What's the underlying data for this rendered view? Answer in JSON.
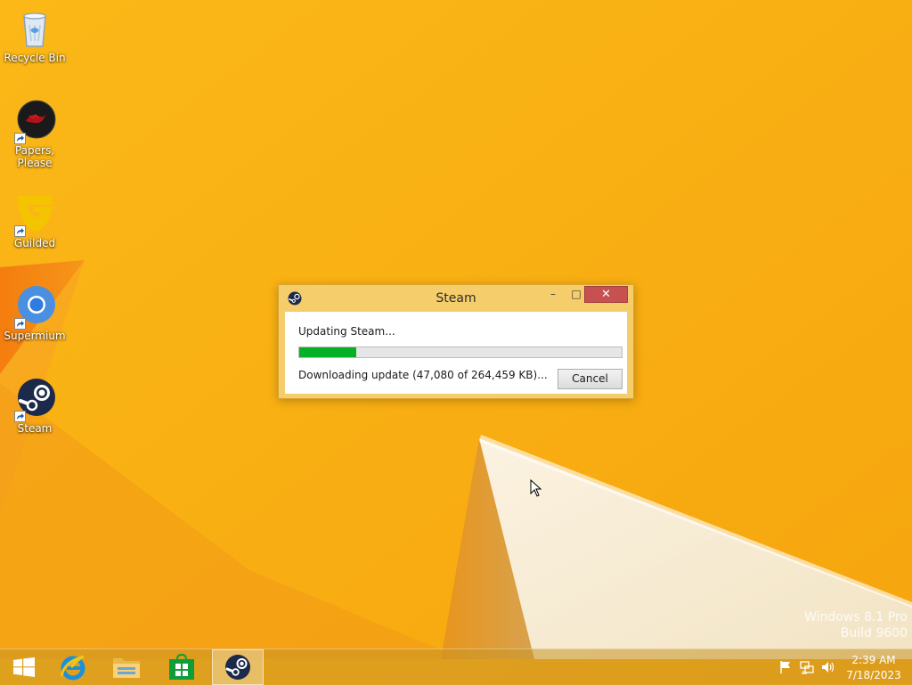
{
  "desktop": {
    "icons": [
      {
        "label": "Recycle Bin",
        "icon": "recycle-bin-icon"
      },
      {
        "label": "Papers, Please",
        "icon": "papers-please-icon"
      },
      {
        "label": "Guilded",
        "icon": "guilded-icon"
      },
      {
        "label": "Supermium",
        "icon": "supermium-icon"
      },
      {
        "label": "Steam",
        "icon": "steam-icon"
      }
    ]
  },
  "dialog": {
    "title": "Steam",
    "status": "Updating Steam...",
    "detail": "Downloading update (47,080 of 264,459 KB)...",
    "cancel_label": "Cancel",
    "progress_fraction": 0.178,
    "minimize_symbol": "–",
    "maximize_symbol": "□",
    "close_symbol": "✕"
  },
  "watermark": {
    "line1": "Windows 8.1 Pro",
    "line2": "Build 9600"
  },
  "taskbar": {
    "items": [
      "start-button",
      "internet-explorer",
      "file-explorer",
      "windows-store",
      "steam"
    ],
    "active_item": "steam"
  },
  "tray": {
    "time": "2:39 AM",
    "date": "7/18/2023"
  },
  "colors": {
    "accent": "#f7b015",
    "dialog_frame": "#f5cd6b",
    "close_button": "#c75050",
    "progress_fill": "#06b025"
  }
}
